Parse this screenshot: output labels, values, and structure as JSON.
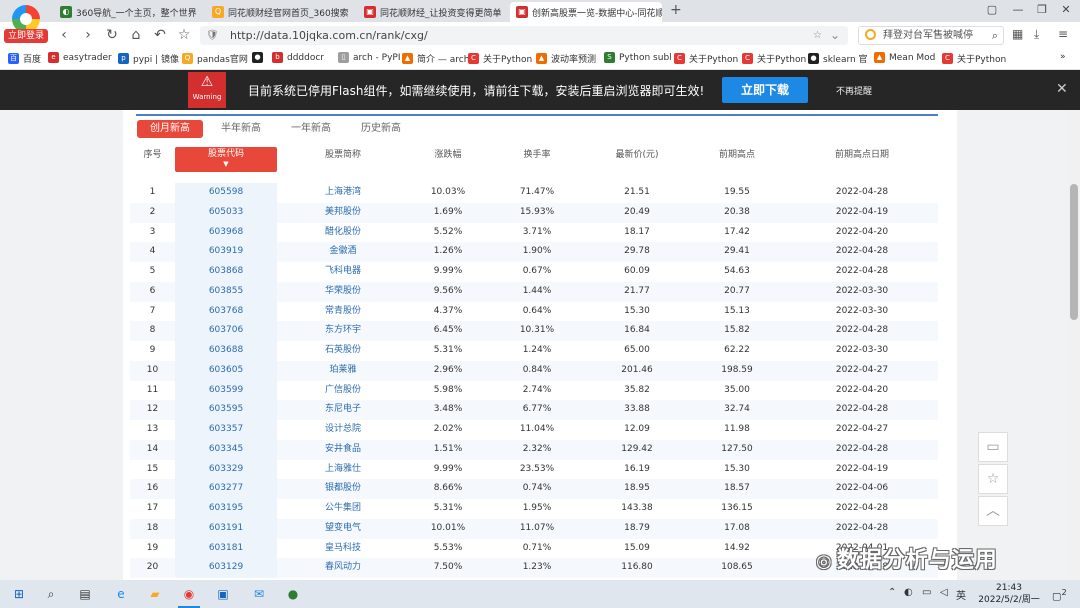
{
  "browser": {
    "login_label": "立即登录",
    "tabs": [
      {
        "title": "360导航_一个主页，整个世界",
        "icon_color": "#2e7d32",
        "icon_name": "360-nav-icon"
      },
      {
        "title": "同花顺财经官网首页_360搜索",
        "icon_color": "#f9a825",
        "icon_name": "360-search-icon"
      },
      {
        "title": "同花顺财经_让投资变得更简单",
        "icon_color": "#d32f2f",
        "icon_name": "ths-icon"
      },
      {
        "title": "创新高股票一览-数据中心-同花顺",
        "icon_color": "#d32f2f",
        "icon_name": "ths-icon"
      }
    ],
    "new_tab_glyph": "+",
    "url": "http://data.10jqka.com.cn/rank/cxg/",
    "search_text": "拜登对台军售被喊停",
    "bookmarks": [
      {
        "label": "百度",
        "icon_color": "#2962ff"
      },
      {
        "label": "easytrader",
        "icon_color": "#d32f2f"
      },
      {
        "label": "pypi | 镜像",
        "icon_color": "#1565c0"
      },
      {
        "label": "pandas官网",
        "icon_color": "#f9a825"
      },
      {
        "label": "",
        "icon_color": "#222222"
      },
      {
        "label": "ddddocr",
        "icon_color": "#d32f2f"
      },
      {
        "label": "arch - PyPI",
        "icon_color": "#9e9e9e"
      },
      {
        "label": "简介 — arch",
        "icon_color": "#ef6c00"
      },
      {
        "label": "关于Python",
        "icon_color": "#e53935"
      },
      {
        "label": "波动率预测",
        "icon_color": "#ef6c00"
      },
      {
        "label": "Python subl",
        "icon_color": "#2e7d32"
      },
      {
        "label": "关于Python",
        "icon_color": "#e53935"
      },
      {
        "label": "关于Python",
        "icon_color": "#e53935"
      },
      {
        "label": "sklearn 官",
        "icon_color": "#222222"
      },
      {
        "label": "Mean Mod",
        "icon_color": "#ef6c00"
      },
      {
        "label": "关于Python",
        "icon_color": "#e53935"
      }
    ],
    "more_bookmarks": "»"
  },
  "flash_bar": {
    "warning_label": "Warning",
    "message": "目前系统已停用Flash组件，如需继续使用，请前往下载，安装后重启浏览器即可生效!",
    "download_label": "立即下载",
    "no_remind_label": "不再提醒",
    "close_glyph": "✕"
  },
  "page": {
    "subtabs": [
      "创月新高",
      "半年新高",
      "一年新高",
      "历史新高"
    ],
    "headers": {
      "idx": "序号",
      "code": "股票代码",
      "name": "股票简称",
      "chg": "涨跌幅",
      "turnover": "换手率",
      "price": "最新价(元)",
      "prev_high": "前期高点",
      "prev_high_date": "前期高点日期"
    },
    "rows": [
      {
        "idx": "1",
        "code": "605598",
        "name": "上海港湾",
        "chg": "10.03%",
        "turnover": "71.47%",
        "price": "21.51",
        "prev_high": "19.55",
        "date": "2022-04-28"
      },
      {
        "idx": "2",
        "code": "605033",
        "name": "美邦股份",
        "chg": "1.69%",
        "turnover": "15.93%",
        "price": "20.49",
        "prev_high": "20.38",
        "date": "2022-04-19"
      },
      {
        "idx": "3",
        "code": "603968",
        "name": "醋化股份",
        "chg": "5.52%",
        "turnover": "3.71%",
        "price": "18.17",
        "prev_high": "17.42",
        "date": "2022-04-20"
      },
      {
        "idx": "4",
        "code": "603919",
        "name": "金徽酒",
        "chg": "1.26%",
        "turnover": "1.90%",
        "price": "29.78",
        "prev_high": "29.41",
        "date": "2022-04-28"
      },
      {
        "idx": "5",
        "code": "603868",
        "name": "飞科电器",
        "chg": "9.99%",
        "turnover": "0.67%",
        "price": "60.09",
        "prev_high": "54.63",
        "date": "2022-04-28"
      },
      {
        "idx": "6",
        "code": "603855",
        "name": "华荣股份",
        "chg": "9.56%",
        "turnover": "1.44%",
        "price": "21.77",
        "prev_high": "20.77",
        "date": "2022-03-30"
      },
      {
        "idx": "7",
        "code": "603768",
        "name": "常青股份",
        "chg": "4.37%",
        "turnover": "0.64%",
        "price": "15.30",
        "prev_high": "15.13",
        "date": "2022-03-30"
      },
      {
        "idx": "8",
        "code": "603706",
        "name": "东方环宇",
        "chg": "6.45%",
        "turnover": "10.31%",
        "price": "16.84",
        "prev_high": "15.82",
        "date": "2022-04-28"
      },
      {
        "idx": "9",
        "code": "603688",
        "name": "石英股份",
        "chg": "5.31%",
        "turnover": "1.24%",
        "price": "65.00",
        "prev_high": "62.22",
        "date": "2022-03-30"
      },
      {
        "idx": "10",
        "code": "603605",
        "name": "珀莱雅",
        "chg": "2.96%",
        "turnover": "0.84%",
        "price": "201.46",
        "prev_high": "198.59",
        "date": "2022-04-27"
      },
      {
        "idx": "11",
        "code": "603599",
        "name": "广信股份",
        "chg": "5.98%",
        "turnover": "2.74%",
        "price": "35.82",
        "prev_high": "35.00",
        "date": "2022-04-20"
      },
      {
        "idx": "12",
        "code": "603595",
        "name": "东尼电子",
        "chg": "3.48%",
        "turnover": "6.77%",
        "price": "33.88",
        "prev_high": "32.74",
        "date": "2022-04-28"
      },
      {
        "idx": "13",
        "code": "603357",
        "name": "设计总院",
        "chg": "2.02%",
        "turnover": "11.04%",
        "price": "12.09",
        "prev_high": "11.98",
        "date": "2022-04-27"
      },
      {
        "idx": "14",
        "code": "603345",
        "name": "安井食品",
        "chg": "1.51%",
        "turnover": "2.32%",
        "price": "129.42",
        "prev_high": "127.50",
        "date": "2022-04-28"
      },
      {
        "idx": "15",
        "code": "603329",
        "name": "上海雅仕",
        "chg": "9.99%",
        "turnover": "23.53%",
        "price": "16.19",
        "prev_high": "15.30",
        "date": "2022-04-19"
      },
      {
        "idx": "16",
        "code": "603277",
        "name": "银都股份",
        "chg": "8.66%",
        "turnover": "0.74%",
        "price": "18.95",
        "prev_high": "18.57",
        "date": "2022-04-06"
      },
      {
        "idx": "17",
        "code": "603195",
        "name": "公牛集团",
        "chg": "5.31%",
        "turnover": "1.95%",
        "price": "143.38",
        "prev_high": "136.15",
        "date": "2022-04-28"
      },
      {
        "idx": "18",
        "code": "603191",
        "name": "望变电气",
        "chg": "10.01%",
        "turnover": "11.07%",
        "price": "18.79",
        "prev_high": "17.08",
        "date": "2022-04-28"
      },
      {
        "idx": "19",
        "code": "603181",
        "name": "皇马科技",
        "chg": "5.53%",
        "turnover": "0.71%",
        "price": "15.09",
        "prev_high": "14.92",
        "date": "2022-04-01"
      },
      {
        "idx": "20",
        "code": "603129",
        "name": "春风动力",
        "chg": "7.50%",
        "turnover": "1.23%",
        "price": "116.80",
        "prev_high": "108.65",
        "date": "2022-04-28"
      }
    ]
  },
  "watermark": "数据分析与运用",
  "taskbar": {
    "time": "21:43",
    "date": "2022/5/2/周一",
    "ime": "英",
    "notification_count": "2"
  }
}
